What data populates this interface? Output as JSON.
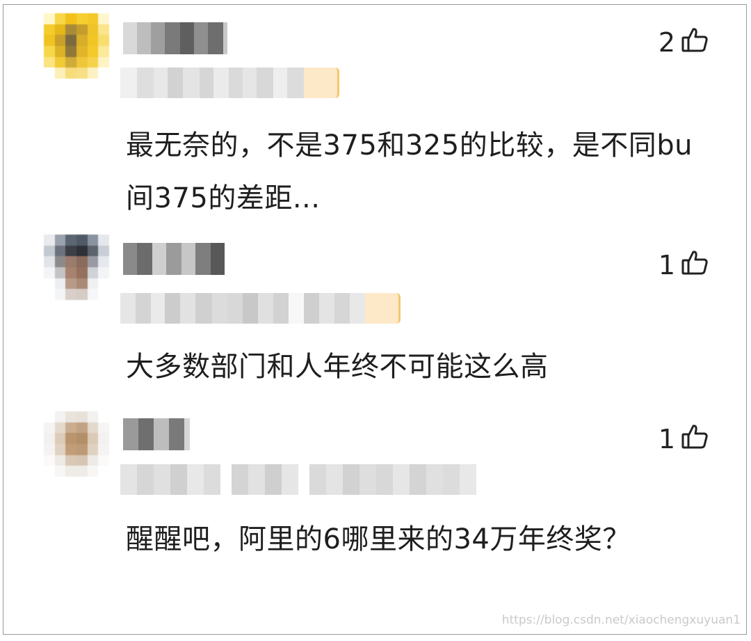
{
  "comments": [
    {
      "likes": "2",
      "text": "最无奈的，不是375和325的比较，是不同bu间375的差距...",
      "avatar_colors": [
        "#fff7c8",
        "#f7d64a",
        "#f2c21b",
        "#f5cf2e",
        "#f4c828",
        "#fff6cf",
        "#f4cc2c",
        "#e4b71a",
        "#a88a3a",
        "#c49d2c",
        "#efc32a",
        "#fbe48a",
        "#f0c322",
        "#c8a02a",
        "#7c6a3e",
        "#d7ad2a",
        "#f0c627",
        "#f9dd6e",
        "#f8d64a",
        "#dcb226",
        "#8f7838",
        "#e0b52a",
        "#f3c92b",
        "#fce99a",
        "#fbe481",
        "#f2c936",
        "#cfab3a",
        "#efc63a",
        "#f6d24a",
        "#fff3c4",
        "#ffffff",
        "#fcefb8",
        "#f6dc7a",
        "#f7df86",
        "#fdf1c2",
        "#ffffff"
      ]
    },
    {
      "likes": "1",
      "text": "大多数部门和人年终不可能这么高",
      "avatar_colors": [
        "#e8eaee",
        "#9aa2ad",
        "#5c6572",
        "#4f5a66",
        "#8b93a0",
        "#e4e7eb",
        "#c3c9d1",
        "#6d737e",
        "#3c3f46",
        "#2e3138",
        "#5c636d",
        "#c9ced6",
        "#e1e4e8",
        "#8d8a8c",
        "#9b7b6c",
        "#8a6c5c",
        "#9a9ba2",
        "#e5e8ec",
        "#f3f4f6",
        "#c6c3c4",
        "#a7826f",
        "#94705d",
        "#cfd2d7",
        "#f3f4f6",
        "#ffffff",
        "#eceef0",
        "#b89a88",
        "#a98a77",
        "#eef0f2",
        "#ffffff",
        "#ffffff",
        "#f4f5f7",
        "#d9cfc9",
        "#d6ccc6",
        "#f6f7f8",
        "#ffffff"
      ]
    },
    {
      "likes": "1",
      "text": "醒醒吧，阿里的6哪里来的34万年终奖？",
      "avatar_colors": [
        "#ffffff",
        "#f4f2f0",
        "#e9e3dc",
        "#e7e1da",
        "#f3f1ef",
        "#ffffff",
        "#f5f4f3",
        "#e4d9cd",
        "#c9ad8e",
        "#c1a282",
        "#e2d8cc",
        "#f6f5f4",
        "#f3f1ef",
        "#dccbb8",
        "#b9946c",
        "#b38f69",
        "#dbcab8",
        "#f4f2f0",
        "#f5f3f1",
        "#e1d3c4",
        "#c29e78",
        "#bd9a75",
        "#e0d2c3",
        "#f6f4f2",
        "#fbfaf9",
        "#eeeae6",
        "#d9c8b5",
        "#d6c5b2",
        "#eeeae6",
        "#fbfaf9",
        "#ffffff",
        "#f7f6f5",
        "#efebe7",
        "#efebe7",
        "#f7f6f5",
        "#ffffff"
      ]
    }
  ],
  "watermark": "https://blog.csdn.net/xiaochengxuyuan1"
}
